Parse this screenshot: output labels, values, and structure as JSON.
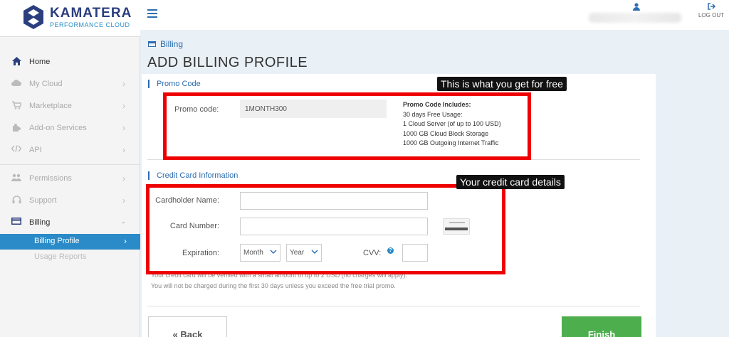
{
  "logo": {
    "name": "KAMATERA",
    "subtitle": "PERFORMANCE CLOUD"
  },
  "sidebar": {
    "items": [
      {
        "label": "Home",
        "icon": "home-icon"
      },
      {
        "label": "My Cloud",
        "icon": "cloud-icon"
      },
      {
        "label": "Marketplace",
        "icon": "cart-icon"
      },
      {
        "label": "Add-on Services",
        "icon": "puzzle-icon"
      },
      {
        "label": "API",
        "icon": "code-icon"
      },
      {
        "label": "Permissions",
        "icon": "users-icon"
      },
      {
        "label": "Support",
        "icon": "headset-icon"
      },
      {
        "label": "Billing",
        "icon": "credit-card-icon"
      }
    ],
    "billing_sub": [
      {
        "label": "Billing Profile"
      },
      {
        "label": "Usage Reports"
      }
    ],
    "chevron": "›"
  },
  "topbar": {
    "logout_label": "LOG OUT"
  },
  "breadcrumb": "Billing",
  "page_title": "ADD BILLING PROFILE",
  "promo": {
    "section_title": "Promo Code",
    "label": "Promo code:",
    "value": "1MONTH300",
    "includes_title": "Promo Code Includes:",
    "includes": [
      "30 days Free Usage:",
      "1 Cloud Server (of up to 100 USD)",
      "1000 GB Cloud Block Storage",
      "1000 GB Outgoing Internet Traffic"
    ]
  },
  "credit_card": {
    "section_title": "Credit Card Information",
    "cardholder_label": "Cardholder Name:",
    "card_number_label": "Card Number:",
    "expiration_label": "Expiration:",
    "month_placeholder": "Month",
    "year_placeholder": "Year",
    "cvv_label": "CVV:",
    "help_icon": "?",
    "note1": "Your credit card will be verified with a small amount of up to 2 USD (no charges will apply).",
    "note2": "You will not be charged during the first 30 days unless you exceed the free trial promo."
  },
  "buttons": {
    "back": "« Back",
    "finish": "Finish"
  },
  "annotations": {
    "promo_callout": "This is what you get for free",
    "card_callout": "Your credit card details",
    "highlight_color": "#e00000"
  },
  "colors": {
    "brand": "#2b3e7e",
    "accent": "#2a8bc8",
    "finish": "#4cae4c"
  }
}
